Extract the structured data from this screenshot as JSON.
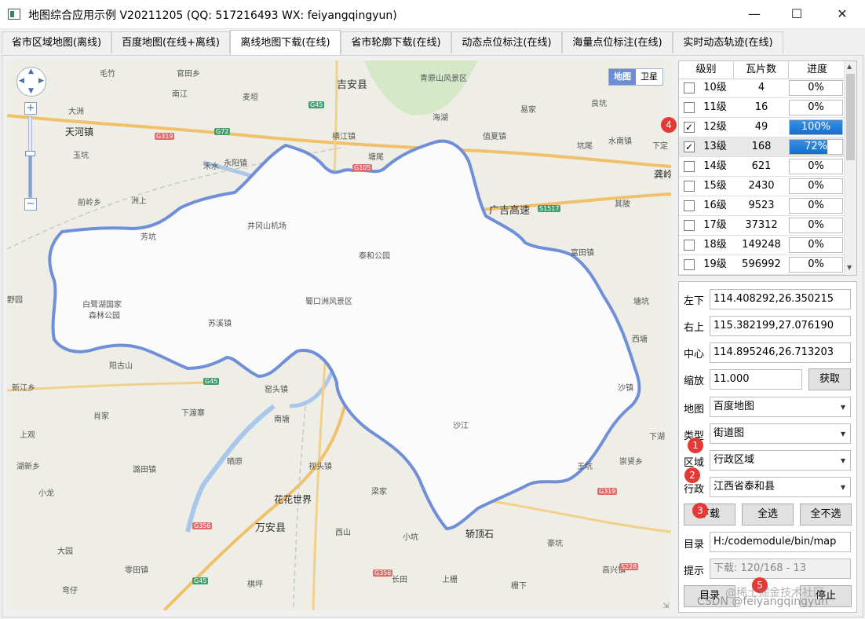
{
  "window": {
    "title": "地图综合应用示例 V20211205 (QQ: 517216493 WX: feiyangqingyun)",
    "minimize": "—",
    "maximize": "☐",
    "close": "✕"
  },
  "tabs": [
    {
      "label": "省市区域地图(离线)"
    },
    {
      "label": "百度地图(在线+离线)"
    },
    {
      "label": "离线地图下载(在线)",
      "active": true
    },
    {
      "label": "省市轮廓下载(在线)"
    },
    {
      "label": "动态点位标注(在线)"
    },
    {
      "label": "海量点位标注(在线)"
    },
    {
      "label": "实时动态轨迹(在线)"
    }
  ],
  "map": {
    "type_toggle": {
      "map": "地图",
      "satellite": "卫星",
      "selected": "地图"
    },
    "zoom_in": "+",
    "zoom_out": "−",
    "zoom_level_fraction": 0.55,
    "labels": [
      {
        "text": "吉安县",
        "cls": "big"
      },
      {
        "text": "青原山风景区",
        "cls": ""
      },
      {
        "text": "毛竹",
        "cls": ""
      },
      {
        "text": "官田乡",
        "cls": ""
      },
      {
        "text": "南江",
        "cls": ""
      },
      {
        "text": "麦垣",
        "cls": ""
      },
      {
        "text": "大洲",
        "cls": ""
      },
      {
        "text": "天河镇",
        "cls": "dark"
      },
      {
        "text": "玉坑",
        "cls": ""
      },
      {
        "text": "禾水",
        "cls": ""
      },
      {
        "text": "永阳镇",
        "cls": ""
      },
      {
        "text": "横江镇",
        "cls": ""
      },
      {
        "text": "塘尾",
        "cls": ""
      },
      {
        "text": "前岭乡",
        "cls": ""
      },
      {
        "text": "洲上",
        "cls": ""
      },
      {
        "text": "芳坑",
        "cls": ""
      },
      {
        "text": "井冈山机场",
        "cls": ""
      },
      {
        "text": "泰和公园",
        "cls": ""
      },
      {
        "text": "广吉高速",
        "cls": "big"
      },
      {
        "text": "富田镇",
        "cls": ""
      },
      {
        "text": "白鹭湖国家",
        "cls": ""
      },
      {
        "text": "森林公园",
        "cls": ""
      },
      {
        "text": "蜀口洲风景区",
        "cls": ""
      },
      {
        "text": "苏溪镇",
        "cls": ""
      },
      {
        "text": "野园",
        "cls": ""
      },
      {
        "text": "阳古山",
        "cls": ""
      },
      {
        "text": "新江乡",
        "cls": ""
      },
      {
        "text": "窑头镇",
        "cls": ""
      },
      {
        "text": "肖家",
        "cls": ""
      },
      {
        "text": "下渡寨",
        "cls": ""
      },
      {
        "text": "南塘",
        "cls": ""
      },
      {
        "text": "上观",
        "cls": ""
      },
      {
        "text": "湖新乡",
        "cls": ""
      },
      {
        "text": "潞田镇",
        "cls": ""
      },
      {
        "text": "晒原",
        "cls": ""
      },
      {
        "text": "视头镇",
        "cls": ""
      },
      {
        "text": "小龙",
        "cls": ""
      },
      {
        "text": "花花世界",
        "cls": "dark"
      },
      {
        "text": "万安县",
        "cls": "big"
      },
      {
        "text": "梁家",
        "cls": ""
      },
      {
        "text": "大园",
        "cls": ""
      },
      {
        "text": "西山",
        "cls": ""
      },
      {
        "text": "小坑",
        "cls": ""
      },
      {
        "text": "轿顶石",
        "cls": "dark"
      },
      {
        "text": "零田镇",
        "cls": ""
      },
      {
        "text": "高兴镇",
        "cls": ""
      },
      {
        "text": "豪坑",
        "cls": ""
      },
      {
        "text": "棋坪",
        "cls": ""
      },
      {
        "text": "长田",
        "cls": ""
      },
      {
        "text": "上栅",
        "cls": ""
      },
      {
        "text": "栅下",
        "cls": ""
      },
      {
        "text": "弯仔",
        "cls": ""
      },
      {
        "text": "下湖",
        "cls": ""
      },
      {
        "text": "王坑",
        "cls": ""
      },
      {
        "text": "崇贤乡",
        "cls": ""
      },
      {
        "text": "沙江",
        "cls": ""
      },
      {
        "text": "塘坑",
        "cls": ""
      },
      {
        "text": "西塘",
        "cls": ""
      },
      {
        "text": "沙镇",
        "cls": ""
      },
      {
        "text": "下定",
        "cls": ""
      },
      {
        "text": "水南镇",
        "cls": ""
      },
      {
        "text": "坑尾",
        "cls": ""
      },
      {
        "text": "值夏镇",
        "cls": ""
      },
      {
        "text": "易家",
        "cls": ""
      },
      {
        "text": "海湖",
        "cls": ""
      },
      {
        "text": "良坑",
        "cls": ""
      },
      {
        "text": "龚岭",
        "cls": "dark"
      },
      {
        "text": "其陂",
        "cls": ""
      }
    ],
    "road_signs": [
      "G45",
      "G72",
      "G319",
      "G105",
      "S1517",
      "G45",
      "G319",
      "G356",
      "S228",
      "G356",
      "G45"
    ]
  },
  "levels_table": {
    "headers": [
      "级别",
      "瓦片数",
      "进度"
    ],
    "rows": [
      {
        "level": "10级",
        "tiles": "4",
        "progress": 0,
        "progress_text": "0%",
        "checked": false
      },
      {
        "level": "11级",
        "tiles": "16",
        "progress": 0,
        "progress_text": "0%",
        "checked": false
      },
      {
        "level": "12级",
        "tiles": "49",
        "progress": 100,
        "progress_text": "100%",
        "checked": true
      },
      {
        "level": "13级",
        "tiles": "168",
        "progress": 72,
        "progress_text": "72%",
        "checked": true,
        "selected": true
      },
      {
        "level": "14级",
        "tiles": "621",
        "progress": 0,
        "progress_text": "0%",
        "checked": false
      },
      {
        "level": "15级",
        "tiles": "2430",
        "progress": 0,
        "progress_text": "0%",
        "checked": false
      },
      {
        "level": "16级",
        "tiles": "9523",
        "progress": 0,
        "progress_text": "0%",
        "checked": false
      },
      {
        "level": "17级",
        "tiles": "37312",
        "progress": 0,
        "progress_text": "0%",
        "checked": false
      },
      {
        "level": "18级",
        "tiles": "149248",
        "progress": 0,
        "progress_text": "0%",
        "checked": false
      },
      {
        "level": "19级",
        "tiles": "596992",
        "progress": 0,
        "progress_text": "0%",
        "checked": false
      }
    ]
  },
  "form": {
    "bottom_left_label": "左下",
    "bottom_left": "114.408292,26.350215",
    "top_right_label": "右上",
    "top_right": "115.382199,27.076190",
    "center_label": "中心",
    "center": "114.895246,26.713203",
    "zoom_label": "缩放",
    "zoom": "11.000",
    "get_button": "获取",
    "map_label": "地图",
    "map_value": "百度地图",
    "type_label": "类型",
    "type_value": "街道图",
    "region_label": "区域",
    "region_value": "行政区域",
    "admin_label": "行政",
    "admin_value": "江西省泰和县",
    "download_button": "下载",
    "select_all_button": "全选",
    "select_none_button": "全不选",
    "dir_label": "目录",
    "dir_value": "H:/codemodule/bin/map",
    "hint_label": "提示",
    "hint_value": "下载: 120/168 - 13",
    "dir_button": "目录",
    "stop_button": "停止"
  },
  "badges": [
    "1",
    "2",
    "3",
    "4",
    "5"
  ],
  "watermark": {
    "line1": "@稀土掘金技术社区",
    "line2": "CSDN @feiyangqingyun"
  },
  "colors": {
    "progress": "#1170cf",
    "boundary": "#6f8fd8",
    "badge": "#e53935"
  }
}
